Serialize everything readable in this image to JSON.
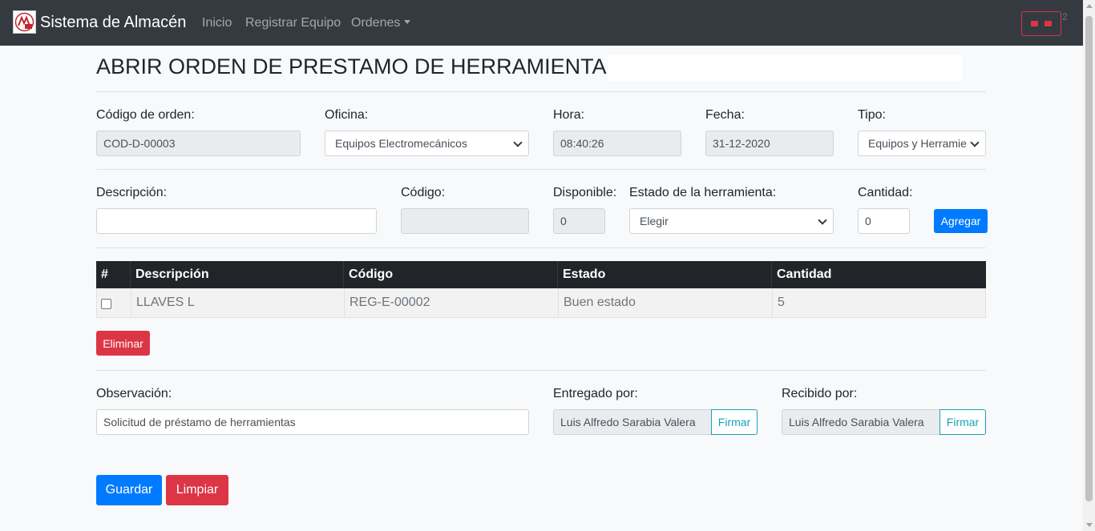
{
  "navbar": {
    "brand": "Sistema de Almacén",
    "links": [
      "Inicio",
      "Registrar Equipo",
      "Ordenes"
    ],
    "superscript": "2",
    "toggler_color": "#dc3545"
  },
  "page": {
    "title": "ABRIR ORDEN DE PRESTAMO DE HERRAMIENTAS"
  },
  "order": {
    "code_label": "Código de orden:",
    "code_value": "COD-D-00003",
    "office_label": "Oficina:",
    "office_value": "Equipos Electromecánicos",
    "time_label": "Hora:",
    "time_value": "08:40:26",
    "date_label": "Fecha:",
    "date_value": "31-12-2020",
    "type_label": "Tipo:",
    "type_value": "Equipos y Herramie"
  },
  "item": {
    "description_label": "Descripción:",
    "description_value": "",
    "code_label": "Código:",
    "code_value": "",
    "available_label": "Disponible:",
    "available_value": "0",
    "state_label": "Estado de la herramienta:",
    "state_value": "Elegir",
    "quantity_label": "Cantidad:",
    "quantity_value": "0",
    "add_button": "Agregar"
  },
  "table": {
    "headers": [
      "#",
      "Descripción",
      "Código",
      "Estado",
      "Cantidad"
    ],
    "rows": [
      {
        "description": "LLAVES L",
        "code": "REG-E-00002",
        "state": "Buen estado",
        "quantity": "5",
        "checked": false
      }
    ],
    "delete_button": "Eliminar"
  },
  "footer": {
    "observation_label": "Observación:",
    "observation_value": "Solicitud de préstamo de herramientas",
    "delivered_label": "Entregado por:",
    "delivered_value": "Luis Alfredo Sarabia Valera",
    "received_label": "Recibido por:",
    "received_value": "Luis Alfredo Sarabia Valera",
    "sign_button": "Firmar"
  },
  "actions": {
    "save": "Guardar",
    "clear": "Limpiar"
  },
  "colors": {
    "primary": "#007bff",
    "danger": "#dc3545",
    "info": "#17a2b8",
    "navbar": "#343a40"
  }
}
